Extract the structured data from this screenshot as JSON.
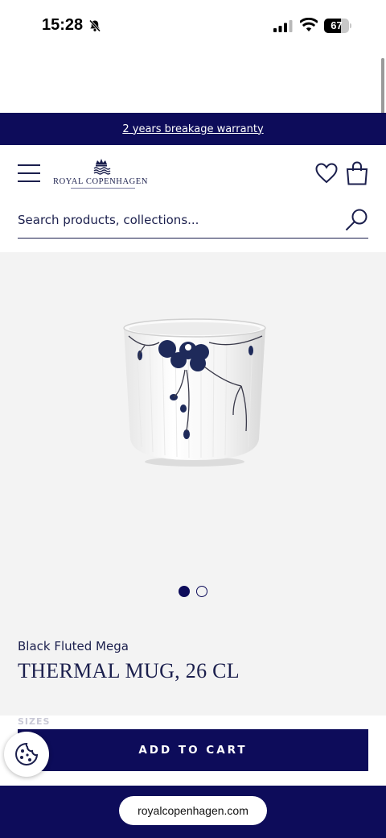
{
  "status_bar": {
    "time": "15:28",
    "battery_level": "67",
    "battery_fraction": 0.67,
    "icons": [
      "bell-slash-icon",
      "signal-icon",
      "wifi-icon",
      "battery-icon"
    ]
  },
  "promo": {
    "text": "2 years breakage warranty"
  },
  "header": {
    "logo_text": "ROYAL COPENHAGEN",
    "menu_icon": "hamburger-menu-icon",
    "wishlist_icon": "heart-icon",
    "cart_icon": "shopping-bag-icon",
    "search_placeholder": "Search products, collections...",
    "search_icon": "search-icon"
  },
  "product": {
    "collection": "Black Fluted Mega",
    "title": "THERMAL MUG, 26 CL",
    "image_count": 2,
    "active_image": 1,
    "sizes_label": "SIZES"
  },
  "actions": {
    "add_to_cart_label": "ADD TO CART",
    "cookie_icon": "cookie-icon"
  },
  "browser": {
    "url": "royalcopenhagen.com"
  },
  "colors": {
    "brand_navy": "#0d0c5a",
    "text_navy": "#1b1f4d",
    "gallery_bg": "#f3f3f3"
  }
}
